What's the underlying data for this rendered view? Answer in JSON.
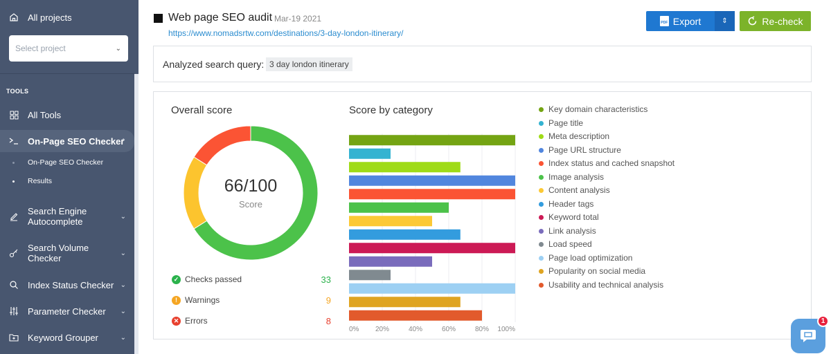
{
  "sidebar": {
    "all_projects": "All projects",
    "select_project_placeholder": "Select project",
    "tools_heading": "TOOLS",
    "items": [
      {
        "label": "All Tools",
        "icon": "grid-icon"
      },
      {
        "label": "On-Page SEO Checker",
        "icon": "terminal-icon",
        "expanded": true
      },
      {
        "label": "Search Engine Autocomplete",
        "icon": "pencil-icon"
      },
      {
        "label": "Search Volume Checker",
        "icon": "key-icon"
      },
      {
        "label": "Index Status Checker",
        "icon": "search-icon"
      },
      {
        "label": "Parameter Checker",
        "icon": "sliders-icon"
      },
      {
        "label": "Keyword Grouper",
        "icon": "folder-plus-icon"
      }
    ],
    "sub_items": [
      {
        "label": "On-Page SEO Checker",
        "active": false
      },
      {
        "label": "Results",
        "active": true
      }
    ]
  },
  "header": {
    "title": "Web page SEO audit",
    "date": "Mar-19 2021",
    "url": "https://www.nomadsrtw.com/destinations/3-day-london-itinerary/",
    "export_label": "Export",
    "recheck_label": "Re-check"
  },
  "query": {
    "label": "Analyzed search query:",
    "value": "3 day london itinerary"
  },
  "overall": {
    "title": "Overall score",
    "score_text": "66/100",
    "score_label": "Score",
    "stats": [
      {
        "label": "Checks passed",
        "value": "33",
        "color": "#2bb24c"
      },
      {
        "label": "Warnings",
        "value": "9",
        "color": "#f5a623"
      },
      {
        "label": "Errors",
        "value": "8",
        "color": "#e8412f"
      }
    ]
  },
  "chart_data": [
    {
      "type": "pie",
      "title": "Overall score",
      "center_text": "66/100",
      "center_label": "Score",
      "slices": [
        {
          "name": "Checks passed",
          "value": 33,
          "color": "#4cc24a"
        },
        {
          "name": "Warnings",
          "value": 9,
          "color": "#fcc42e"
        },
        {
          "name": "Errors",
          "value": 8,
          "color": "#fb5434"
        }
      ]
    },
    {
      "type": "bar",
      "orientation": "horizontal",
      "title": "Score by category",
      "xlim": [
        0,
        100
      ],
      "x_ticks": [
        "0%",
        "20%",
        "40%",
        "60%",
        "80%",
        "100%"
      ],
      "grid": true,
      "legend_position": "right",
      "categories": [
        "Key domain characteristics",
        "Page title",
        "Meta description",
        "Page URL structure",
        "Index status and cached snapshot",
        "Image analysis",
        "Content analysis",
        "Header tags",
        "Keyword total",
        "Link analysis",
        "Load speed",
        "Page load optimization",
        "Popularity on social media",
        "Usability and technical analysis"
      ],
      "values": [
        100,
        25,
        67,
        100,
        100,
        60,
        50,
        67,
        100,
        50,
        25,
        100,
        67,
        80
      ],
      "colors": [
        "#74a413",
        "#34b3d1",
        "#9fdb17",
        "#5186de",
        "#fb5434",
        "#4cc24a",
        "#fcc935",
        "#339cde",
        "#cc1a55",
        "#7a6cbc",
        "#808a90",
        "#9dd0f3",
        "#dfa421",
        "#e25a2c"
      ]
    }
  ],
  "category_title": "Score by category",
  "chat": {
    "badge": "1"
  }
}
